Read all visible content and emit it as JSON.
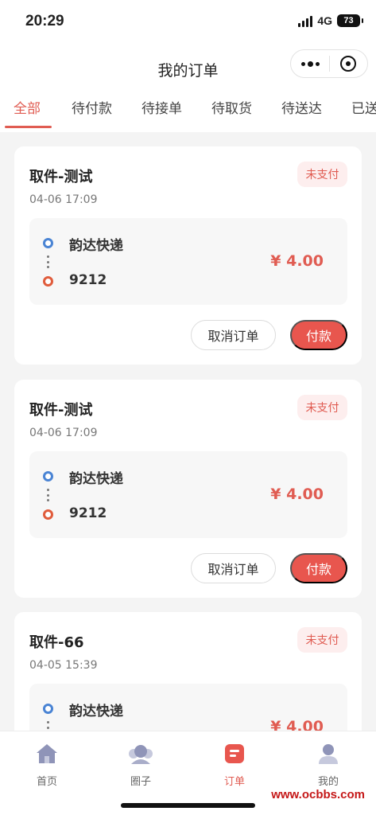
{
  "status_bar": {
    "time": "20:29",
    "network": "4G",
    "battery": "73"
  },
  "nav": {
    "title": "我的订单"
  },
  "tabs": [
    {
      "label": "全部",
      "active": true
    },
    {
      "label": "待付款"
    },
    {
      "label": "待接单"
    },
    {
      "label": "待取货"
    },
    {
      "label": "待送达"
    },
    {
      "label": "已送"
    }
  ],
  "orders": [
    {
      "title": "取件-测试",
      "status": "未支付",
      "time": "04-06 17:09",
      "pickup": "韵达快递",
      "dropoff": "9212",
      "price": "¥ 4.00",
      "cancel_label": "取消订单",
      "pay_label": "付款"
    },
    {
      "title": "取件-测试",
      "status": "未支付",
      "time": "04-06 17:09",
      "pickup": "韵达快递",
      "dropoff": "9212",
      "price": "¥ 4.00",
      "cancel_label": "取消订单",
      "pay_label": "付款"
    },
    {
      "title": "取件-66",
      "status": "未支付",
      "time": "04-05 15:39",
      "pickup": "韵达快递",
      "dropoff": "",
      "price": "¥ 4.00",
      "cancel_label": "",
      "pay_label": ""
    }
  ],
  "tab_bar": [
    {
      "label": "首页",
      "icon": "home-icon"
    },
    {
      "label": "圈子",
      "icon": "circle-icon"
    },
    {
      "label": "订单",
      "icon": "order-icon",
      "active": true
    },
    {
      "label": "我的",
      "icon": "profile-icon"
    }
  ],
  "watermark": "www.ocbbs.com",
  "colors": {
    "accent": "#e05c52",
    "pickup_dot": "#4a84d4",
    "dropoff_dot": "#e05c3c"
  }
}
